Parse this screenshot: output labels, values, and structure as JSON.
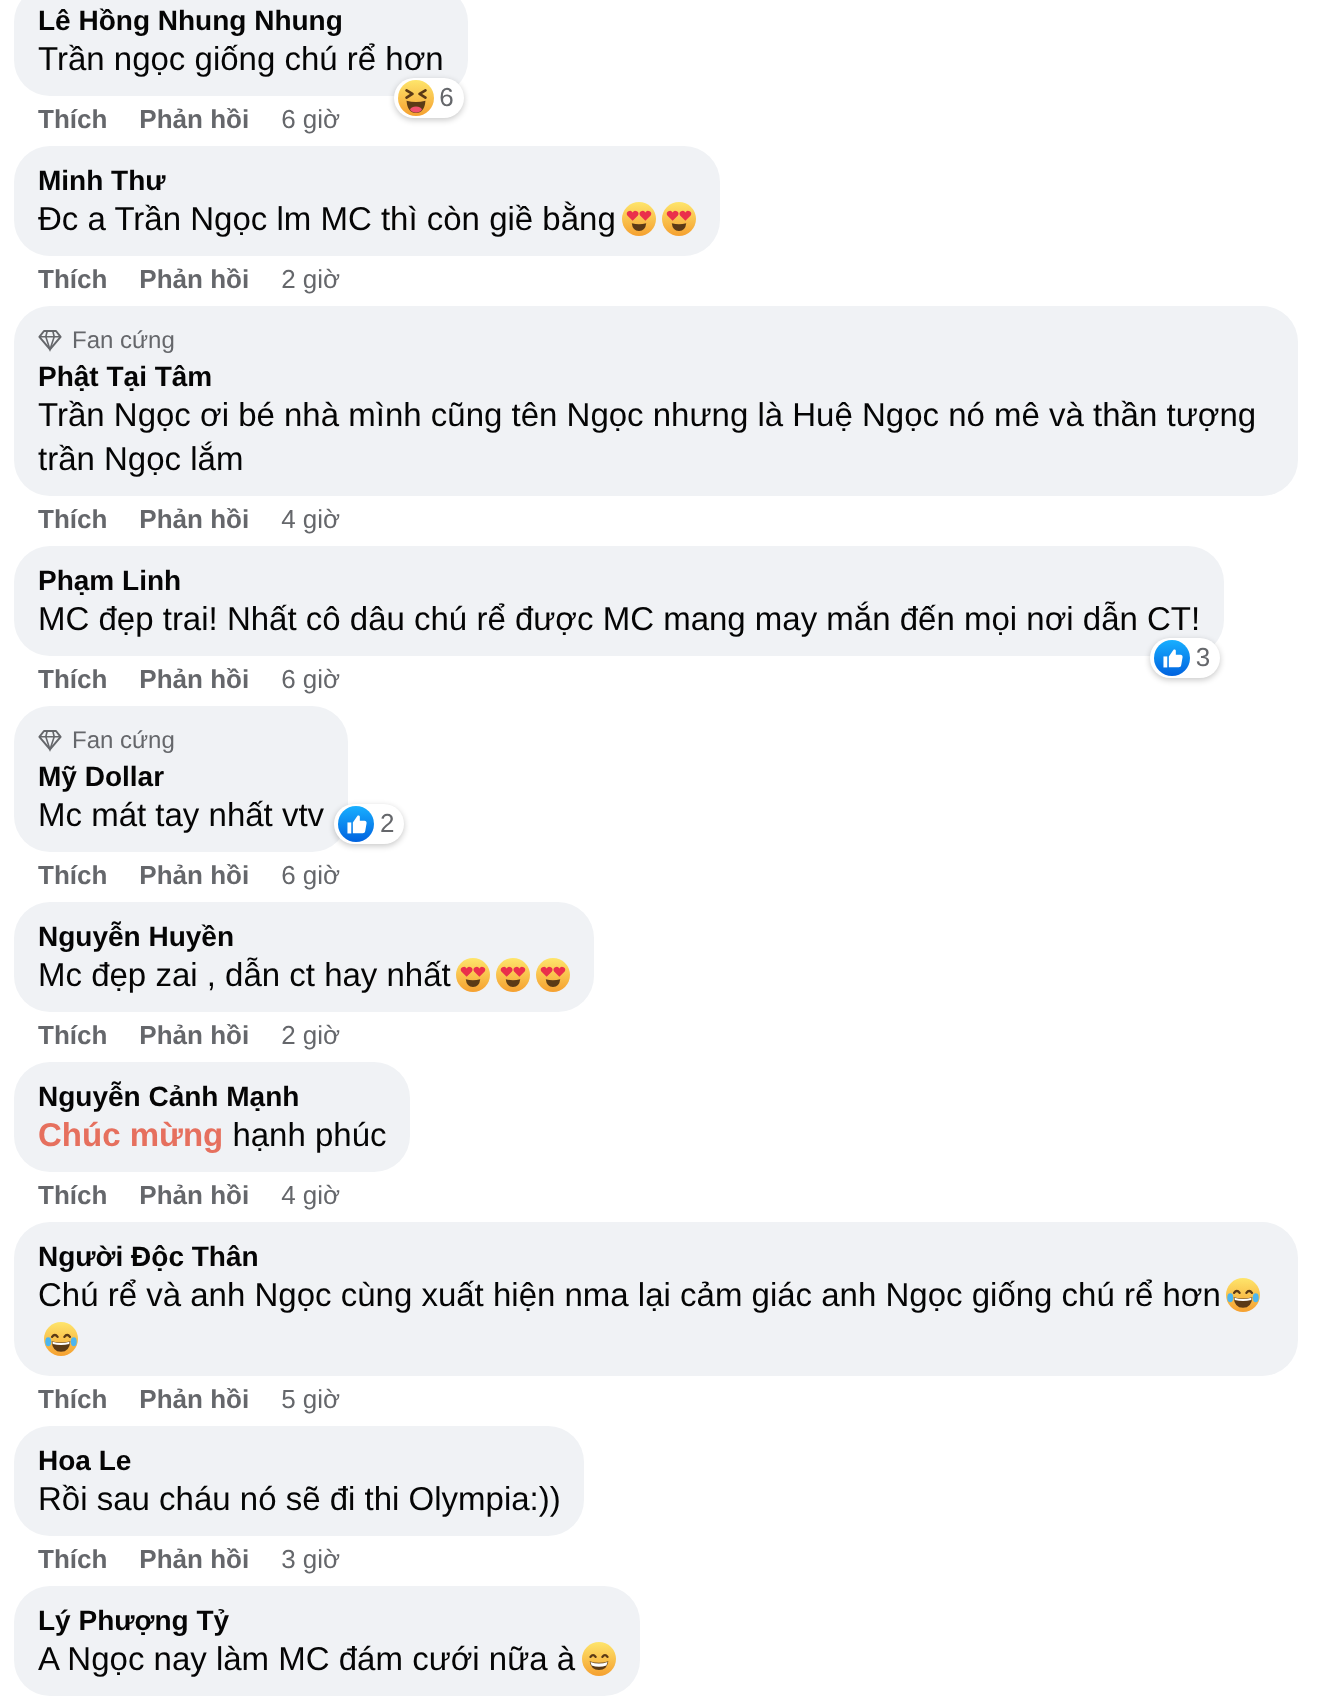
{
  "comments": [
    {
      "author": "Lê Hồng Nhung Nhung",
      "text": "Trần ngọc giống chú rể hơn",
      "reaction": {
        "kind": "haha",
        "count": "6"
      },
      "actions": [
        "Thích",
        "Phản hồi"
      ],
      "time": "6 giờ"
    },
    {
      "author": "Minh Thư",
      "text": "Đc a Trần Ngọc lm MC thì còn giề bằng",
      "emojis": [
        {
          "kind": "hearteyes"
        },
        {
          "kind": "hearteyes"
        }
      ],
      "actions": [
        "Thích",
        "Phản hồi"
      ],
      "time": "2 giờ"
    },
    {
      "badge": "Fan cứng",
      "author": "Phật Tại Tâm",
      "text": "Trần Ngọc ơi bé nhà mình cũng tên Ngọc nhưng là Huệ Ngọc nó mê và thần tượng trần Ngọc lắm",
      "actions": [
        "Thích",
        "Phản hồi"
      ],
      "time": "4 giờ"
    },
    {
      "author": "Phạm Linh",
      "text": "MC đẹp trai! Nhất cô dâu chú rể được MC mang may mắn đến mọi nơi dẫn CT!",
      "reaction": {
        "kind": "like",
        "count": "3"
      },
      "actions": [
        "Thích",
        "Phản hồi"
      ],
      "time": "6 giờ"
    },
    {
      "badge": "Fan cứng",
      "author": "Mỹ Dollar",
      "text": "Mc mát tay nhất vtv",
      "reaction": {
        "kind": "like",
        "count": "2"
      },
      "actions": [
        "Thích",
        "Phản hồi"
      ],
      "time": "6 giờ"
    },
    {
      "author": "Nguyễn Huyền",
      "text": "Mc đẹp zai , dẫn ct hay nhất",
      "emojis": [
        {
          "kind": "hearteyes"
        },
        {
          "kind": "hearteyes"
        },
        {
          "kind": "hearteyes"
        }
      ],
      "actions": [
        "Thích",
        "Phản hồi"
      ],
      "time": "2 giờ"
    },
    {
      "author": "Nguyễn Cảnh Mạnh",
      "text": "**Chúc mừng** hạnh phúc",
      "actions": [
        "Thích",
        "Phản hồi"
      ],
      "time": "4 giờ"
    },
    {
      "author": "Người Độc Thân",
      "text": "Chú rể và anh Ngọc cùng xuất hiện nma lại cảm giác anh Ngọc giống chú rể hơn",
      "emojis": [
        {
          "kind": "tearsofjoy"
        },
        {
          "kind": "tearsofjoy"
        }
      ],
      "actions": [
        "Thích",
        "Phản hồi"
      ],
      "time": "5 giờ"
    },
    {
      "author": "Hoa Le",
      "text": "Rồi sau cháu nó sẽ đi thi Olympia:))",
      "actions": [
        "Thích",
        "Phản hồi"
      ],
      "time": "3 giờ"
    },
    {
      "author": "Lý Phượng Tỷ",
      "text": "A Ngọc nay làm MC đám cưới nữa à",
      "emojis": [
        {
          "kind": "grin"
        }
      ]
    }
  ]
}
